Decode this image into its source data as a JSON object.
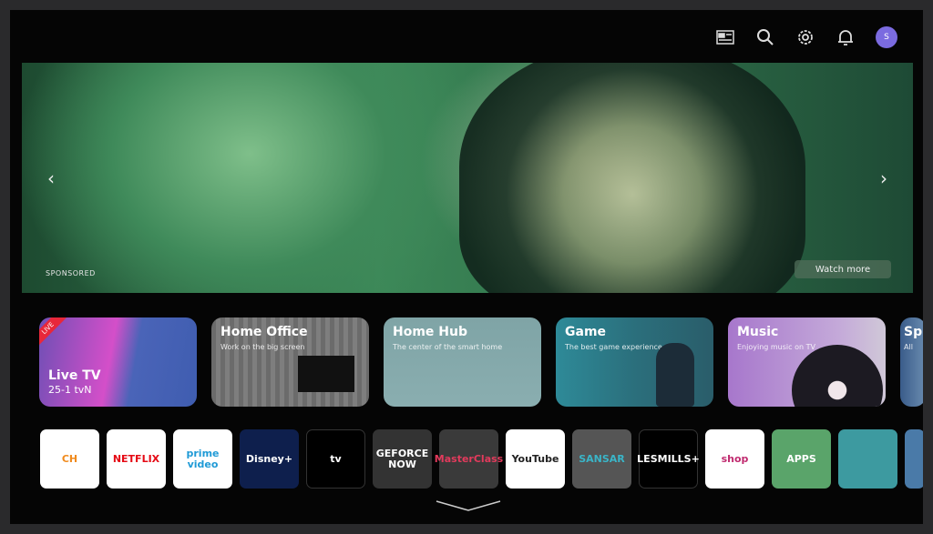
{
  "header": {
    "icons": [
      "guide-icon",
      "search-icon",
      "settings-icon",
      "notifications-icon"
    ],
    "avatar_initial": "S",
    "avatar_color": "#7b6be0"
  },
  "hero": {
    "sponsored_label": "SPONSORED",
    "watch_more_label": "Watch more"
  },
  "cards": [
    {
      "title": "Live TV",
      "subtitle": "25-1  tvN",
      "badge": "LIVE"
    },
    {
      "title": "Home Office",
      "subtitle": "Work on the big screen"
    },
    {
      "title": "Home Hub",
      "subtitle": "The center of the smart home"
    },
    {
      "title": "Game",
      "subtitle": "The best game experience"
    },
    {
      "title": "Music",
      "subtitle": "Enjoying music on TV"
    },
    {
      "title": "Sp",
      "subtitle": "All"
    }
  ],
  "apps": [
    {
      "label": "CH",
      "bg": "#ffffff",
      "fg": "#f08a1c"
    },
    {
      "label": "NETFLIX",
      "bg": "#ffffff",
      "fg": "#e50914"
    },
    {
      "label": "prime video",
      "bg": "#ffffff",
      "fg": "#1f9ad6"
    },
    {
      "label": "Disney+",
      "bg": "#0e1f4d",
      "fg": "#ffffff"
    },
    {
      "label": "tv",
      "bg": "#000000",
      "fg": "#ffffff"
    },
    {
      "label": "GEFORCE NOW",
      "bg": "#333333",
      "fg": "#ffffff"
    },
    {
      "label": "MasterClass",
      "bg": "#3a3a3a",
      "fg": "#e23a5c"
    },
    {
      "label": "YouTube",
      "bg": "#ffffff",
      "fg": "#222222"
    },
    {
      "label": "SANSAR",
      "bg": "#555555",
      "fg": "#3ab5c8"
    },
    {
      "label": "LESMILLS+",
      "bg": "#000000",
      "fg": "#ffffff"
    },
    {
      "label": "shop",
      "bg": "#ffffff",
      "fg": "#c02a6f"
    },
    {
      "label": "APPS",
      "bg": "#5aa46a",
      "fg": "#ffffff"
    },
    {
      "label": "",
      "bg": "#3d9aa0",
      "fg": "#ffffff"
    },
    {
      "label": "",
      "bg": "#4a7aa8",
      "fg": "#ffffff"
    }
  ]
}
